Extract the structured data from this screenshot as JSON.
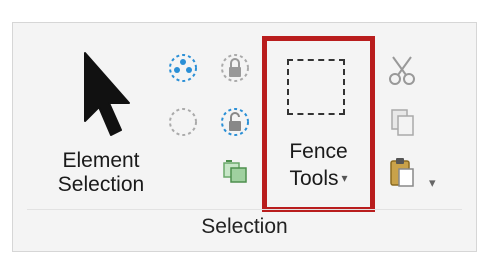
{
  "ribbon": {
    "group_label": "Selection",
    "element_selection": {
      "line1": "Element",
      "line2": "Selection",
      "icon": "arrow-pointer-icon"
    },
    "fence_tools": {
      "line1": "Fence",
      "line2": "Tools",
      "caret": "▾",
      "icon": "dashed-rectangle-icon",
      "highlight_color": "#b91d1d"
    },
    "small_tools": [
      {
        "icon": "select-all-icon"
      },
      {
        "icon": "lock-icon"
      },
      {
        "icon": "empty-circle-selection-icon"
      },
      {
        "icon": "unlock-icon"
      },
      {
        "icon": "copy-to-layer-icon"
      }
    ],
    "clipboard": {
      "tools": [
        {
          "icon": "scissors-icon"
        },
        {
          "icon": "copy-icon"
        },
        {
          "icon": "paste-icon"
        }
      ],
      "caret": "▾"
    }
  }
}
